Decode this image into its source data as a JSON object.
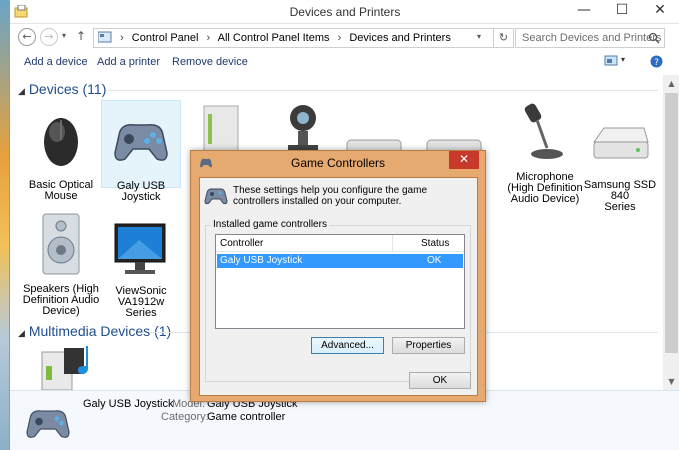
{
  "window": {
    "title": "Devices and Printers"
  },
  "address": {
    "crumbs": [
      "Control Panel",
      "All Control Panel Items",
      "Devices and Printers"
    ],
    "search_placeholder": "Search Devices and Printers"
  },
  "commands": {
    "add_device": "Add a device",
    "add_printer": "Add a printer",
    "remove_device": "Remove device"
  },
  "groups": {
    "devices_header": "Devices (11)",
    "multimedia_header": "Multimedia Devices (1)"
  },
  "devices": [
    {
      "label_1": "Basic Optical",
      "label_2": "Mouse",
      "label_3": ""
    },
    {
      "label_1": "Galy USB Joystick",
      "label_2": "",
      "label_3": ""
    },
    {
      "label_1": "Microphone",
      "label_2": "(High Definition",
      "label_3": "Audio Device)"
    },
    {
      "label_1": "Samsung SSD 840",
      "label_2": "Series",
      "label_3": ""
    },
    {
      "label_1": "Speakers (High",
      "label_2": "Definition Audio",
      "label_3": "Device)"
    },
    {
      "label_1": "ViewSonic",
      "label_2": "VA1912w Series",
      "label_3": ""
    }
  ],
  "details": {
    "name": "Galy USB Joystick",
    "model_label": "Model:",
    "model_value": "Galy USB Joystick",
    "category_label": "Category:",
    "category_value": "Game controller"
  },
  "dialog": {
    "title": "Game Controllers",
    "intro": "These settings help you configure the game controllers installed on your computer.",
    "group_label": "Installed game controllers",
    "col_controller": "Controller",
    "col_status": "Status",
    "rows": [
      {
        "controller": "Galy USB Joystick",
        "status": "OK"
      }
    ],
    "advanced_button": "Advanced...",
    "properties_button": "Properties",
    "ok_button": "OK"
  },
  "colors": {
    "accent_header": "#1e4e8c",
    "dialog_frame": "#e6a96f",
    "close_button": "#c7392b",
    "selection": "#3399ff"
  }
}
